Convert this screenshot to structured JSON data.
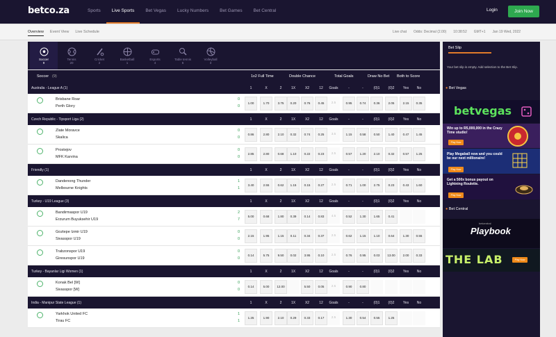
{
  "brand": {
    "logo": "betco.za"
  },
  "nav": {
    "items": [
      "Sports",
      "Live Sports",
      "Bet Vegas",
      "Lucky Numbers",
      "Bet Games",
      "Bet Central"
    ],
    "login": "Login",
    "join": "Join Now"
  },
  "subnav": {
    "tabs": [
      "Overview",
      "Event View",
      "Live Schedule"
    ],
    "live_chat": "Live chat",
    "odds": "Odds: Decimal (2.00)",
    "time": "10:38:52",
    "tz": "GMT+1",
    "date": "Jan 19 Wed, 2022"
  },
  "sports": [
    {
      "name": "Soccer",
      "count": "9",
      "icon": "soccer-icon"
    },
    {
      "name": "Tennis",
      "count": "20",
      "icon": "tennis-icon"
    },
    {
      "name": "Cricket",
      "count": "2",
      "icon": "cricket-icon"
    },
    {
      "name": "Basketball",
      "count": "1",
      "icon": "basketball-icon"
    },
    {
      "name": "Esports",
      "count": "4",
      "icon": "esports-icon"
    },
    {
      "name": "Table tennis",
      "count": "6",
      "icon": "table-tennis-icon"
    },
    {
      "name": "Volleyball",
      "count": "3",
      "icon": "volleyball-icon"
    }
  ],
  "market_header": {
    "title": "Soccer",
    "count": "(9)",
    "markets": [
      "1x2 Full Time",
      "Double Chance",
      "Total Goals",
      "Draw No Bet",
      "Both to Score"
    ]
  },
  "col_labels": [
    "1",
    "X",
    "2",
    "1X",
    "X2",
    "12",
    "Goals",
    "-",
    "-",
    "(0)1",
    "(0)2",
    "Yes",
    "No"
  ],
  "leagues": [
    {
      "name": "Australia - League A (1)",
      "matches": [
        {
          "home": "Brisbane Roar",
          "away": "Perth Glory",
          "hs": "0",
          "as": "0",
          "time": "",
          "odds": [
            "1.00",
            "1.70",
            "3.75",
            "0.20",
            "0.76",
            "0.45",
            "2.5",
            "0.95",
            "0.74",
            "0.36",
            "2.05",
            "2.15",
            "0.35"
          ],
          "more": "61"
        }
      ]
    },
    {
      "name": "Czech Republic - Tipsport Liga (2)",
      "matches": [
        {
          "home": "Zlate Moravce",
          "away": "Skalica",
          "hs": "0",
          "as": "0",
          "time": "",
          "odds": [
            "0.86",
            "2.80",
            "2.10",
            "0.32",
            "0.74",
            "0.25",
            "3.5",
            "1.15",
            "0.58",
            "0.50",
            "1.40",
            "0.47",
            "1.45"
          ],
          "more": "71"
        },
        {
          "home": "Prostejov",
          "away": "MFK Karvina",
          "hs": "0",
          "as": "0",
          "time": "",
          "odds": [
            "2.85",
            "2.80",
            "0.68",
            "1.10",
            "0.22",
            "0.23",
            "2.5",
            "0.57",
            "1.20",
            "2.10",
            "0.32",
            "0.57",
            "1.25"
          ],
          "more": "71"
        }
      ]
    },
    {
      "name": "Friendly (1)",
      "matches": [
        {
          "home": "Dandenong Thunder",
          "away": "Melbourne Knights",
          "hs": "1",
          "as": "1",
          "time": "",
          "odds": [
            "3.40",
            "2.55",
            "0.62",
            "1.15",
            "0.15",
            "0.27",
            "2.5",
            "0.71",
            "1.00",
            "2.75",
            "0.23",
            "0.43",
            "1.60"
          ],
          "more": "24"
        }
      ]
    },
    {
      "name": "Turkey - U19 League (3)",
      "matches": [
        {
          "home": "Bandirmaspor U19",
          "away": "Erzurum Buyuksehir U19",
          "hs": "2",
          "as": "7",
          "time": "",
          "odds": [
            "5.00",
            "0.68",
            "1.80",
            "0.39",
            "0.14",
            "0.83",
            "4.5",
            "0.52",
            "1.30",
            "1.65",
            "0.41",
            "",
            ""
          ],
          "more": "11"
        },
        {
          "home": "Goztepe Izmir U19",
          "away": "Sivasspor U19",
          "hs": "0",
          "as": "0",
          "time": "",
          "odds": [
            "2.15",
            "1.95",
            "1.15",
            "0.11",
            "0.34",
            "0.37",
            "2.5",
            "0.62",
            "1.15",
            "1.10",
            "0.64",
            "1.30",
            "0.55"
          ],
          "more": "35"
        },
        {
          "home": "Trabzonspor U19",
          "away": "Giresunspor U19",
          "hs": "0",
          "as": "0",
          "time": "",
          "odds": [
            "0.14",
            "5.75",
            "9.50",
            "0.02",
            "3.95",
            "0.10",
            "2.5",
            "0.76",
            "0.95",
            "0.03",
            "13.00",
            "2.00",
            "0.33"
          ],
          "more": "35"
        }
      ]
    },
    {
      "name": "Turkey - Bayanlar Ligi Women (1)",
      "matches": [
        {
          "home": "Konak Bel [W]",
          "away": "Sivasspor [W]",
          "hs": "0",
          "as": "0",
          "time": "",
          "odds": [
            "0.14",
            "5.00",
            "12.00",
            "",
            "5.50",
            "0.05",
            "2.5",
            "0.90",
            "0.80",
            "",
            "",
            "",
            ""
          ],
          "more": "36"
        }
      ]
    },
    {
      "name": "India - Manipur State League (1)",
      "matches": [
        {
          "home": "Yarkhok United FC",
          "away": "Tirau FC",
          "hs": "1",
          "as": "1",
          "time": "",
          "odds": [
            "1.25",
            "1.90",
            "2.10",
            "0.29",
            "0.33",
            "0.17",
            "2.5",
            "1.30",
            "0.54",
            "0.55",
            "1.25",
            "",
            ""
          ],
          "more": "37"
        }
      ]
    }
  ],
  "betslip": {
    "tab": "Bet Slip",
    "empty": "Your bet slip is empty. Add selection to the Bet Slip.",
    "section1": "Bet Vegas",
    "section2": "Bet Central",
    "promos": [
      {
        "brand": "betvegas"
      },
      {
        "text": "Win up to R5,000,000 in the Crazy Time studio!",
        "cta": "Play Now"
      },
      {
        "text": "Play Megaball now and you could be our next millionaire!",
        "cta": "Play Now"
      },
      {
        "text": "Get a 500x bonus payout on Lightning Roulette.",
        "cta": "Play Now"
      }
    ],
    "central": [
      {
        "brand": "Playbook",
        "sub": "betcentral"
      },
      {
        "brand": "THE LAB",
        "cta": "Play Now"
      }
    ]
  },
  "colors": {
    "nav_bg": "#1a1530",
    "accent": "#e17b2a",
    "green": "#2ea84f",
    "red": "#d93a3a"
  }
}
